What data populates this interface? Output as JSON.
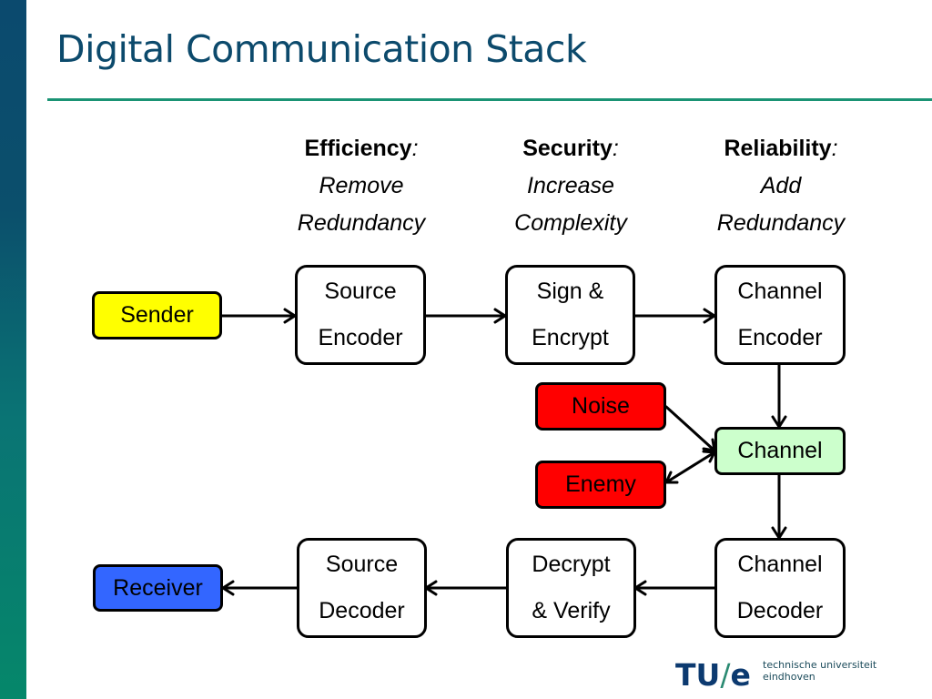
{
  "slide": {
    "title": "Digital Communication Stack",
    "colors": {
      "title": "#0c4a6c",
      "rule": "#1a9374",
      "sender": "#ffff00",
      "receiver": "#3366ff",
      "noise": "#ff0000",
      "enemy": "#ff0000",
      "channel": "#ccffcc"
    }
  },
  "headers": [
    {
      "name": "Efficiency",
      "colon": ":",
      "line1": "Remove",
      "line2": "Redundancy"
    },
    {
      "name": "Security",
      "colon": ":",
      "line1": "Increase",
      "line2": "Complexity"
    },
    {
      "name": "Reliability",
      "colon": ":",
      "line1": "Add",
      "line2": "Redundancy"
    }
  ],
  "nodes": {
    "sender": "Sender",
    "source_encoder": [
      "Source",
      "Encoder"
    ],
    "sign_encrypt": [
      "Sign &",
      "Encrypt"
    ],
    "channel_encoder": [
      "Channel",
      "Encoder"
    ],
    "noise": "Noise",
    "channel": "Channel",
    "enemy": "Enemy",
    "channel_decoder": [
      "Channel",
      "Decoder"
    ],
    "decrypt_verify": [
      "Decrypt",
      "& Verify"
    ],
    "source_decoder": [
      "Source",
      "Decoder"
    ],
    "receiver": "Receiver"
  },
  "edges": [
    {
      "from": "sender",
      "to": "source_encoder"
    },
    {
      "from": "source_encoder",
      "to": "sign_encrypt"
    },
    {
      "from": "sign_encrypt",
      "to": "channel_encoder"
    },
    {
      "from": "channel_encoder",
      "to": "channel"
    },
    {
      "from": "noise",
      "to": "channel"
    },
    {
      "from": "channel",
      "to": "enemy",
      "bidirectional": true
    },
    {
      "from": "channel",
      "to": "channel_decoder"
    },
    {
      "from": "channel_decoder",
      "to": "decrypt_verify"
    },
    {
      "from": "decrypt_verify",
      "to": "source_decoder"
    },
    {
      "from": "source_decoder",
      "to": "receiver"
    }
  ],
  "footer": {
    "logo": {
      "part1": "TU",
      "slash": "/",
      "part2": "e"
    },
    "university": "technische universiteit eindhoven"
  }
}
